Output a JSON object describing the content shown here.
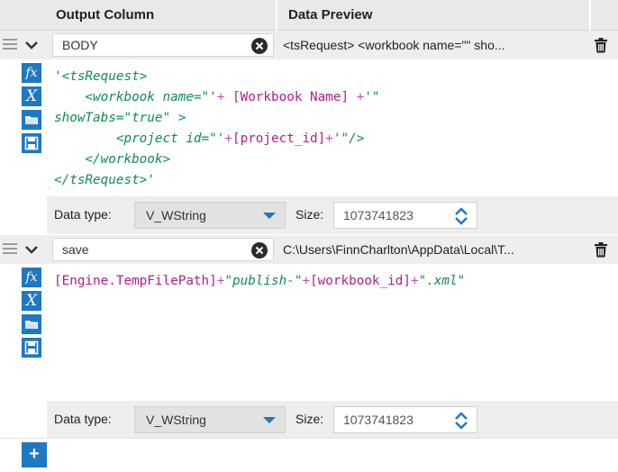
{
  "header": {
    "output_column": "Output Column",
    "data_preview": "Data Preview"
  },
  "rows": [
    {
      "name": "BODY",
      "preview": "<tsRequest> <workbook name=\"\" sho...",
      "data_type": "V_WString",
      "size": "1073741823"
    },
    {
      "name": "save",
      "preview": "C:\\Users\\FinnCharlton\\AppData\\Local\\T...",
      "data_type": "V_WString",
      "size": "1073741823"
    }
  ],
  "labels": {
    "data_type": "Data type:",
    "size": "Size:"
  },
  "code1": {
    "l1": "'<tsRequest>",
    "l2a": "    <workbook name=\"'",
    "l2b": "+ ",
    "l2c": "[Workbook Name]",
    "l2d": " +",
    "l2e": "'\"",
    "l3": "showTabs=\"true\" >",
    "l4a": "        <project id=\"'",
    "l4b": "+",
    "l4c": "[project_id]",
    "l4d": "+",
    "l4e": "'\"/>",
    "l5": "    </workbook>",
    "l6": "</tsRequest>'"
  },
  "code2": {
    "a": "[Engine.TempFilePath]",
    "b": "+",
    "c": "\"publish-\"",
    "d": "+",
    "e": "[workbook_id]",
    "f": "+",
    "g": "\".xml\""
  },
  "icons": {
    "fx": "fx",
    "var": "X"
  },
  "colors": {
    "accent": "#1e78c2",
    "string": "#0f8c50",
    "field": "#b0208a"
  }
}
